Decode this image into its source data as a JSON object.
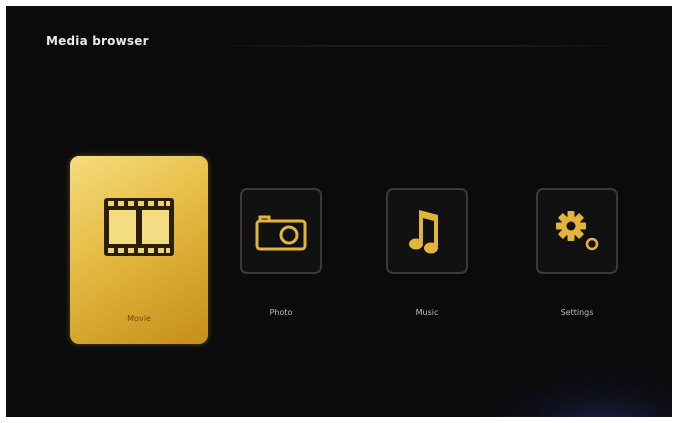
{
  "header": {
    "title": "Media browser"
  },
  "menu": {
    "items": [
      {
        "id": "movie",
        "label": "Movie",
        "icon": "film-strip-icon",
        "selected": true
      },
      {
        "id": "photo",
        "label": "Photo",
        "icon": "camera-icon",
        "selected": false
      },
      {
        "id": "music",
        "label": "Music",
        "icon": "music-note-icon",
        "selected": false
      },
      {
        "id": "settings",
        "label": "Settings",
        "icon": "gear-icon",
        "selected": false
      }
    ]
  },
  "colors": {
    "background": "#0b0b0c",
    "accent": "#e5b83e",
    "icon": "#e2b43a",
    "tile_border": "#3a3a3a",
    "text": "#e8e8e8"
  }
}
